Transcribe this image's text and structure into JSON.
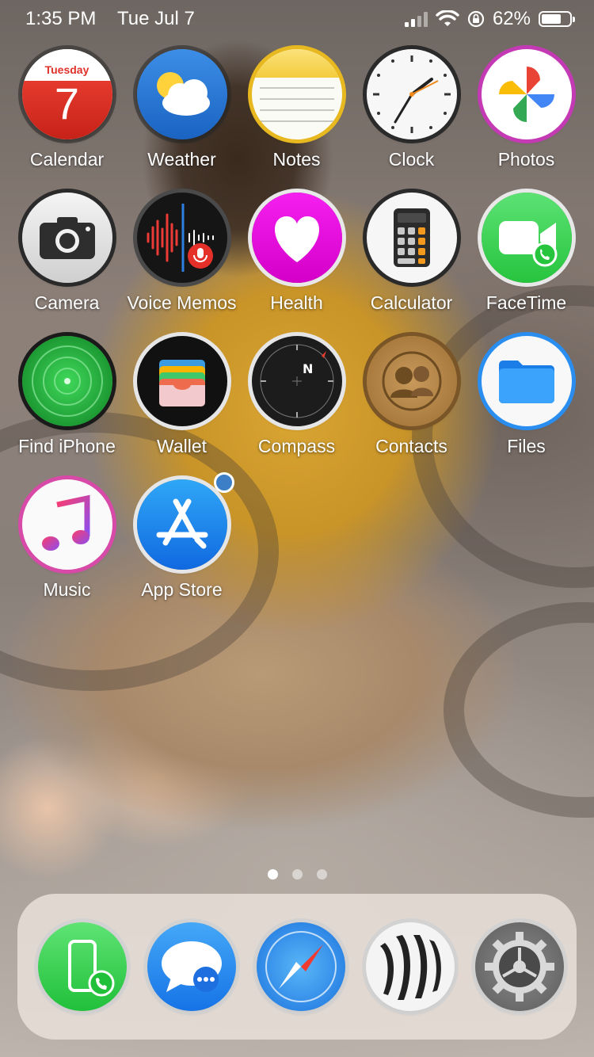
{
  "status_bar": {
    "time": "1:35 PM",
    "date": "Tue Jul 7",
    "battery": "62%",
    "battery_level": 0.62
  },
  "apps": [
    {
      "id": "calendar",
      "label": "Calendar",
      "icon": "calendar-icon",
      "calendar_day": "Tuesday",
      "calendar_date": "7"
    },
    {
      "id": "weather",
      "label": "Weather",
      "icon": "weather-icon"
    },
    {
      "id": "notes",
      "label": "Notes",
      "icon": "notes-icon"
    },
    {
      "id": "clock",
      "label": "Clock",
      "icon": "clock-icon"
    },
    {
      "id": "photos",
      "label": "Photos",
      "icon": "photos-icon"
    },
    {
      "id": "camera",
      "label": "Camera",
      "icon": "camera-icon"
    },
    {
      "id": "voice-memos",
      "label": "Voice Memos",
      "icon": "voice-memos-icon"
    },
    {
      "id": "health",
      "label": "Health",
      "icon": "health-icon"
    },
    {
      "id": "calculator",
      "label": "Calculator",
      "icon": "calculator-icon"
    },
    {
      "id": "facetime",
      "label": "FaceTime",
      "icon": "facetime-icon"
    },
    {
      "id": "find-iphone",
      "label": "Find iPhone",
      "icon": "find-iphone-icon"
    },
    {
      "id": "wallet",
      "label": "Wallet",
      "icon": "wallet-icon"
    },
    {
      "id": "compass",
      "label": "Compass",
      "icon": "compass-icon"
    },
    {
      "id": "contacts",
      "label": "Contacts",
      "icon": "contacts-icon"
    },
    {
      "id": "files",
      "label": "Files",
      "icon": "files-icon"
    },
    {
      "id": "music",
      "label": "Music",
      "icon": "music-icon"
    },
    {
      "id": "app-store",
      "label": "App Store",
      "icon": "app-store-icon"
    }
  ],
  "page_indicator": {
    "pages": 3,
    "current": 1
  },
  "dock": [
    {
      "id": "phone",
      "icon": "phone-icon"
    },
    {
      "id": "messages",
      "icon": "messages-icon"
    },
    {
      "id": "safari",
      "icon": "safari-icon"
    },
    {
      "id": "zebra-app",
      "icon": "zebra-stripes-icon"
    },
    {
      "id": "settings",
      "icon": "settings-gear-icon"
    }
  ]
}
